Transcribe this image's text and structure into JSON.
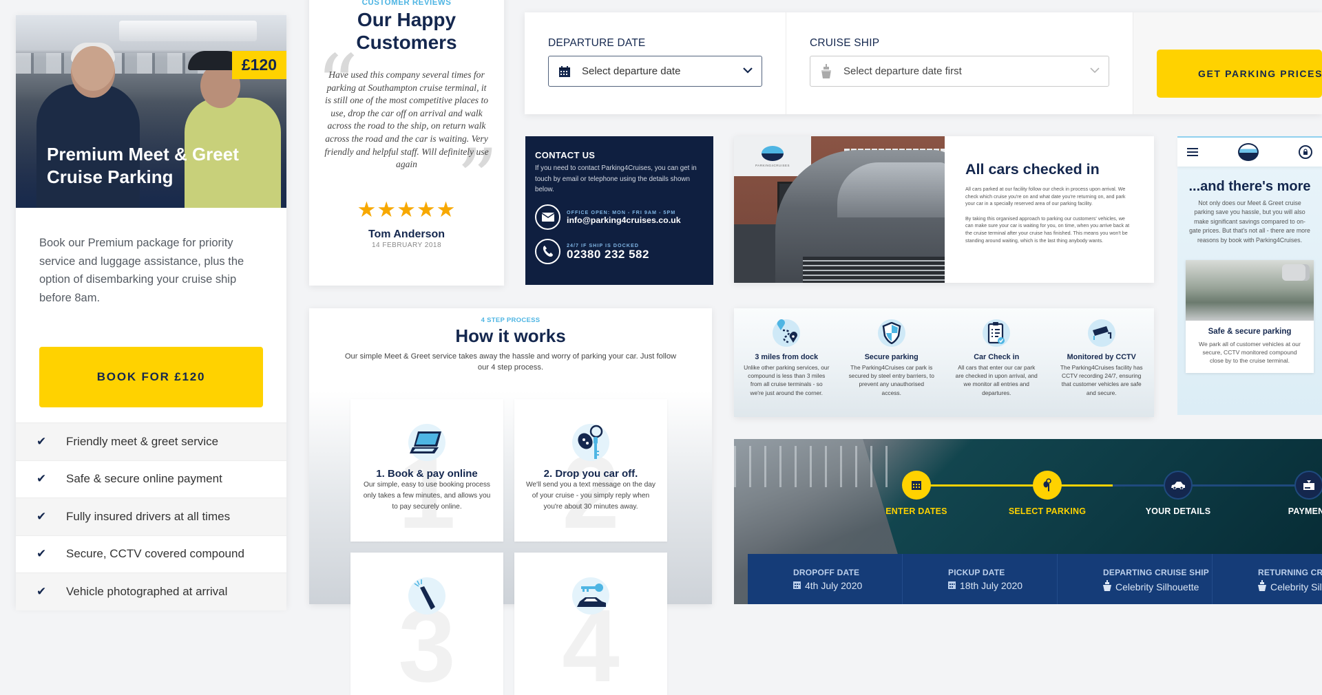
{
  "premium": {
    "price_badge": "£120",
    "title": "Premium Meet & Greet Cruise Parking",
    "description": "Book our Premium package for priority service and luggage assistance, plus the option of disembarking your cruise ship before 8am.",
    "book_button": "BOOK FOR £120",
    "features": [
      "Friendly meet & greet service",
      "Safe & secure online payment",
      "Fully insured drivers at all times",
      "Secure, CCTV covered compound",
      "Vehicle photographed at arrival"
    ],
    "feature_icon": "check-icon"
  },
  "reviews": {
    "eyebrow": "CUSTOMER REVIEWS",
    "title": "Our Happy Customers",
    "quote": "Have used this company several times for parking at Southampton cruise terminal, it is still one of the most competitive places to use, drop the car off on arrival and walk across the road to the ship, on return walk across the road and the car is waiting. Very friendly and helpful staff. Will definitely use again",
    "rating": 5,
    "rating_max": 5,
    "stars": "★★★★★",
    "reviewer": "Tom Anderson",
    "date": "14 FEBRUARY 2018"
  },
  "search": {
    "departure_label": "DEPARTURE DATE",
    "departure_placeholder": "Select departure date",
    "ship_label": "CRUISE SHIP",
    "ship_placeholder": "Select departure date first",
    "button": "GET PARKING PRICES"
  },
  "contact": {
    "title": "CONTACT US",
    "text": "If you need to contact Parking4Cruises, you can get in touch by email or telephone using the details shown below.",
    "email_caption": "OFFICE OPEN: MON - FRI 9AM - 5PM",
    "email": "info@parking4cruises.co.uk",
    "phone_caption": "24/7 IF SHIP IS DOCKED",
    "phone": "02380 232 582"
  },
  "checked_in": {
    "sign_text": "PARKING4CRUISES",
    "title": "All cars checked in",
    "para1": "All cars parked at our facility follow our check in process upon arrival. We check which cruise you're on and what date you're returning on, and park your car in a specially reserved area of our parking facility.",
    "para2": "By taking this organised approach to parking our customers' vehicles, we can make sure your car is waiting for you, on time, when you arrive back at the cruise terminal after your cruise has finished. This means you won't be standing around waiting, which is the last thing anybody wants."
  },
  "more": {
    "title": "...and there's more",
    "text": "Not only does our Meet & Greet cruise parking save you hassle, but you will also make significant savings compared to on-gate prices. But that's not all - there are more reasons by book with Parking4Cruises.",
    "card_title": "Safe & secure parking",
    "card_text": "We park all of customer vehicles at our secure, CCTV monitored compound close by to the cruise terminal."
  },
  "how": {
    "eyebrow": "4 STEP PROCESS",
    "title": "How it works",
    "text": "Our simple Meet & Greet service takes away the hassle and worry of parking your car. Just follow our 4 step process.",
    "steps": [
      {
        "number": "1",
        "title": "1. Book & pay online",
        "text": "Our simple, easy to use booking process only takes a few minutes, and allows you to pay securely online.",
        "icon": "laptop-icon"
      },
      {
        "number": "2",
        "title": "2. Drop you car off.",
        "text": "We'll send you a text message on the day of your cruise - you simply reply when you're about 30 minutes away.",
        "icon": "car-key-icon"
      },
      {
        "number": "3",
        "title": "",
        "text": "",
        "icon": "champagne-icon"
      },
      {
        "number": "4",
        "title": "",
        "text": "",
        "icon": "car-key-return-icon"
      }
    ]
  },
  "benefits": [
    {
      "title": "3 miles from dock",
      "text": "Unlike other parking services, our compound is less than 3 miles from all cruise terminals - so we're just around the corner.",
      "icon": "route-pin-icon"
    },
    {
      "title": "Secure parking",
      "text": "The Parking4Cruises car park is secured by steel entry barriers, to prevent any unauthorised access.",
      "icon": "shield-icon"
    },
    {
      "title": "Car Check in",
      "text": "All cars that enter our car park are checked in upon arrival, and we monitor all entries and departures.",
      "icon": "clipboard-check-icon"
    },
    {
      "title": "Monitored by CCTV",
      "text": "The Parking4Cruises facility has CCTV recording 24/7, ensuring that customer vehicles are safe and secure.",
      "icon": "cctv-camera-icon"
    }
  ],
  "progress": {
    "steps": [
      {
        "label": "ENTER DATES",
        "status": "done",
        "icon": "calendar-icon"
      },
      {
        "label": "SELECT PARKING",
        "status": "done",
        "icon": "car-key-icon"
      },
      {
        "label": "YOUR DETAILS",
        "status": "todo",
        "icon": "car-icon"
      },
      {
        "label": "PAYMENT",
        "status": "todo",
        "icon": "card-payment-icon"
      }
    ],
    "completed_steps": 2,
    "summary": [
      {
        "label": "DROPOFF DATE",
        "value": "4th July 2020",
        "icon": "calendar-icon"
      },
      {
        "label": "PICKUP DATE",
        "value": "18th July 2020",
        "icon": "calendar-icon"
      },
      {
        "label": "DEPARTING CRUISE SHIP",
        "value": "Celebrity Silhouette",
        "icon": "ship-icon"
      },
      {
        "label": "RETURNING CRUISE SHIP",
        "value": "Celebrity Silhouette",
        "icon": "ship-icon"
      }
    ]
  },
  "colors": {
    "navy": "#14274e",
    "yellow": "#ffd200",
    "sky": "#4eb5e3",
    "star": "#f7a800"
  }
}
